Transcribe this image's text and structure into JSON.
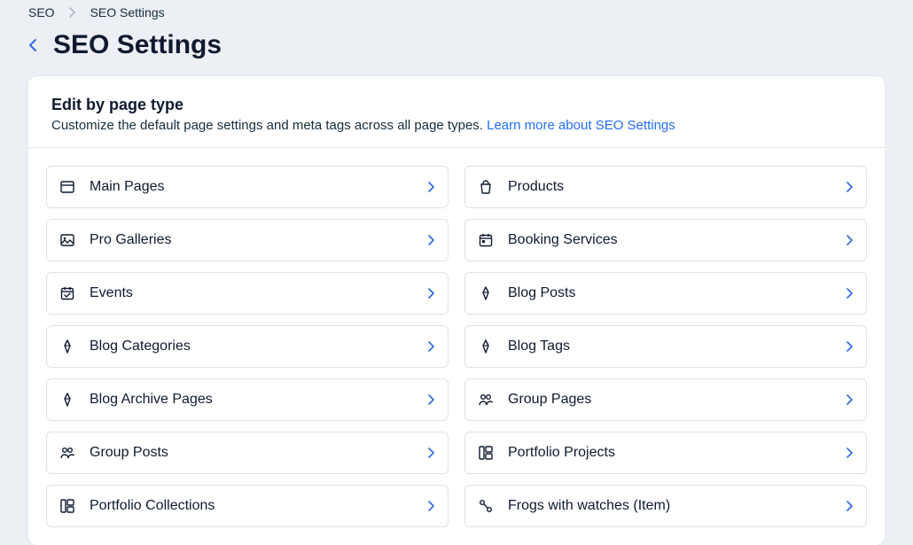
{
  "breadcrumbs": {
    "item1": "SEO",
    "item2": "SEO Settings"
  },
  "page": {
    "title": "SEO Settings"
  },
  "card": {
    "title": "Edit by page type",
    "description": "Customize the default page settings and meta tags across all page types. ",
    "learn_more": "Learn more about SEO Settings"
  },
  "rows": {
    "main_pages": "Main Pages",
    "products": "Products",
    "pro_galleries": "Pro Galleries",
    "booking_services": "Booking Services",
    "events": "Events",
    "blog_posts": "Blog Posts",
    "blog_categories": "Blog Categories",
    "blog_tags": "Blog Tags",
    "blog_archive": "Blog Archive Pages",
    "group_pages": "Group Pages",
    "group_posts": "Group Posts",
    "portfolio_projects": "Portfolio Projects",
    "portfolio_collections": "Portfolio Collections",
    "frogs": "Frogs with watches (Item)"
  }
}
